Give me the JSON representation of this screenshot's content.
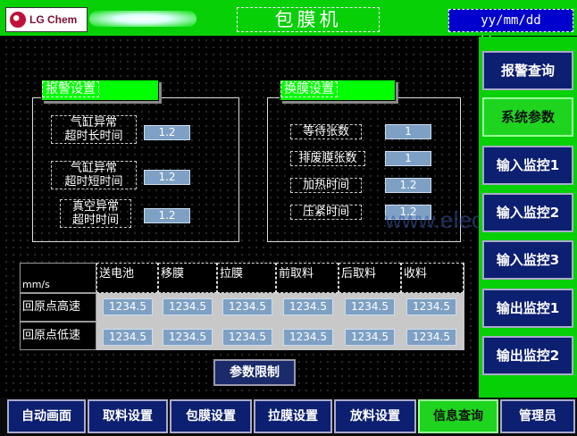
{
  "header": {
    "logo_text": "LG Chem",
    "title": "包膜机",
    "datetime": "yy/mm/dd hh:mm:ss"
  },
  "alarm_panel": {
    "title": "报警设置",
    "rows": [
      {
        "label": [
          "气缸异常",
          "超时长时间"
        ],
        "value": "1.2"
      },
      {
        "label": [
          "气缸异常",
          "超时短时间"
        ],
        "value": "1.2"
      },
      {
        "label": [
          "真空异常",
          "超时时间"
        ],
        "value": "1.2"
      }
    ]
  },
  "film_panel": {
    "title": "换膜设置",
    "rows": [
      {
        "label": "等待张数",
        "value": "1"
      },
      {
        "label": "排废膜张数",
        "value": "1"
      },
      {
        "label": "加热时间",
        "value": "1.2"
      },
      {
        "label": "压紧时间",
        "value": "1.2"
      }
    ]
  },
  "speed_table": {
    "unit": "mm/s",
    "columns": [
      "送电池",
      "移膜",
      "拉膜",
      "前取料",
      "后取料",
      "收料"
    ],
    "rows": [
      {
        "label": "回原点高速",
        "values": [
          "1234.5",
          "1234.5",
          "1234.5",
          "1234.5",
          "1234.5",
          "1234.5"
        ]
      },
      {
        "label": "回原点低速",
        "values": [
          "1234.5",
          "1234.5",
          "1234.5",
          "1234.5",
          "1234.5",
          "1234.5"
        ]
      }
    ]
  },
  "param_limit_button": "参数限制",
  "right_menu": [
    {
      "label": "报警查询",
      "active": false
    },
    {
      "label": "系统参数",
      "active": true
    },
    {
      "label": "输入监控1",
      "active": false
    },
    {
      "label": "输入监控2",
      "active": false
    },
    {
      "label": "输入监控3",
      "active": false
    },
    {
      "label": "输出监控1",
      "active": false
    },
    {
      "label": "输出监控2",
      "active": false
    }
  ],
  "bottom_menu": [
    {
      "label": "自动画面",
      "active": false
    },
    {
      "label": "取料设置",
      "active": false
    },
    {
      "label": "包膜设置",
      "active": false
    },
    {
      "label": "拉膜设置",
      "active": false
    },
    {
      "label": "放料设置",
      "active": false
    },
    {
      "label": "信息查询",
      "active": true
    },
    {
      "label": "管理员",
      "active": false
    }
  ],
  "watermark": "www.eleok.com",
  "colors": {
    "header_green": "#07d007",
    "button_navy": "#0c1f70",
    "active_green": "#1fd41f",
    "value_blue": "#7ea0c4",
    "clock_blue": "#0000cc"
  }
}
